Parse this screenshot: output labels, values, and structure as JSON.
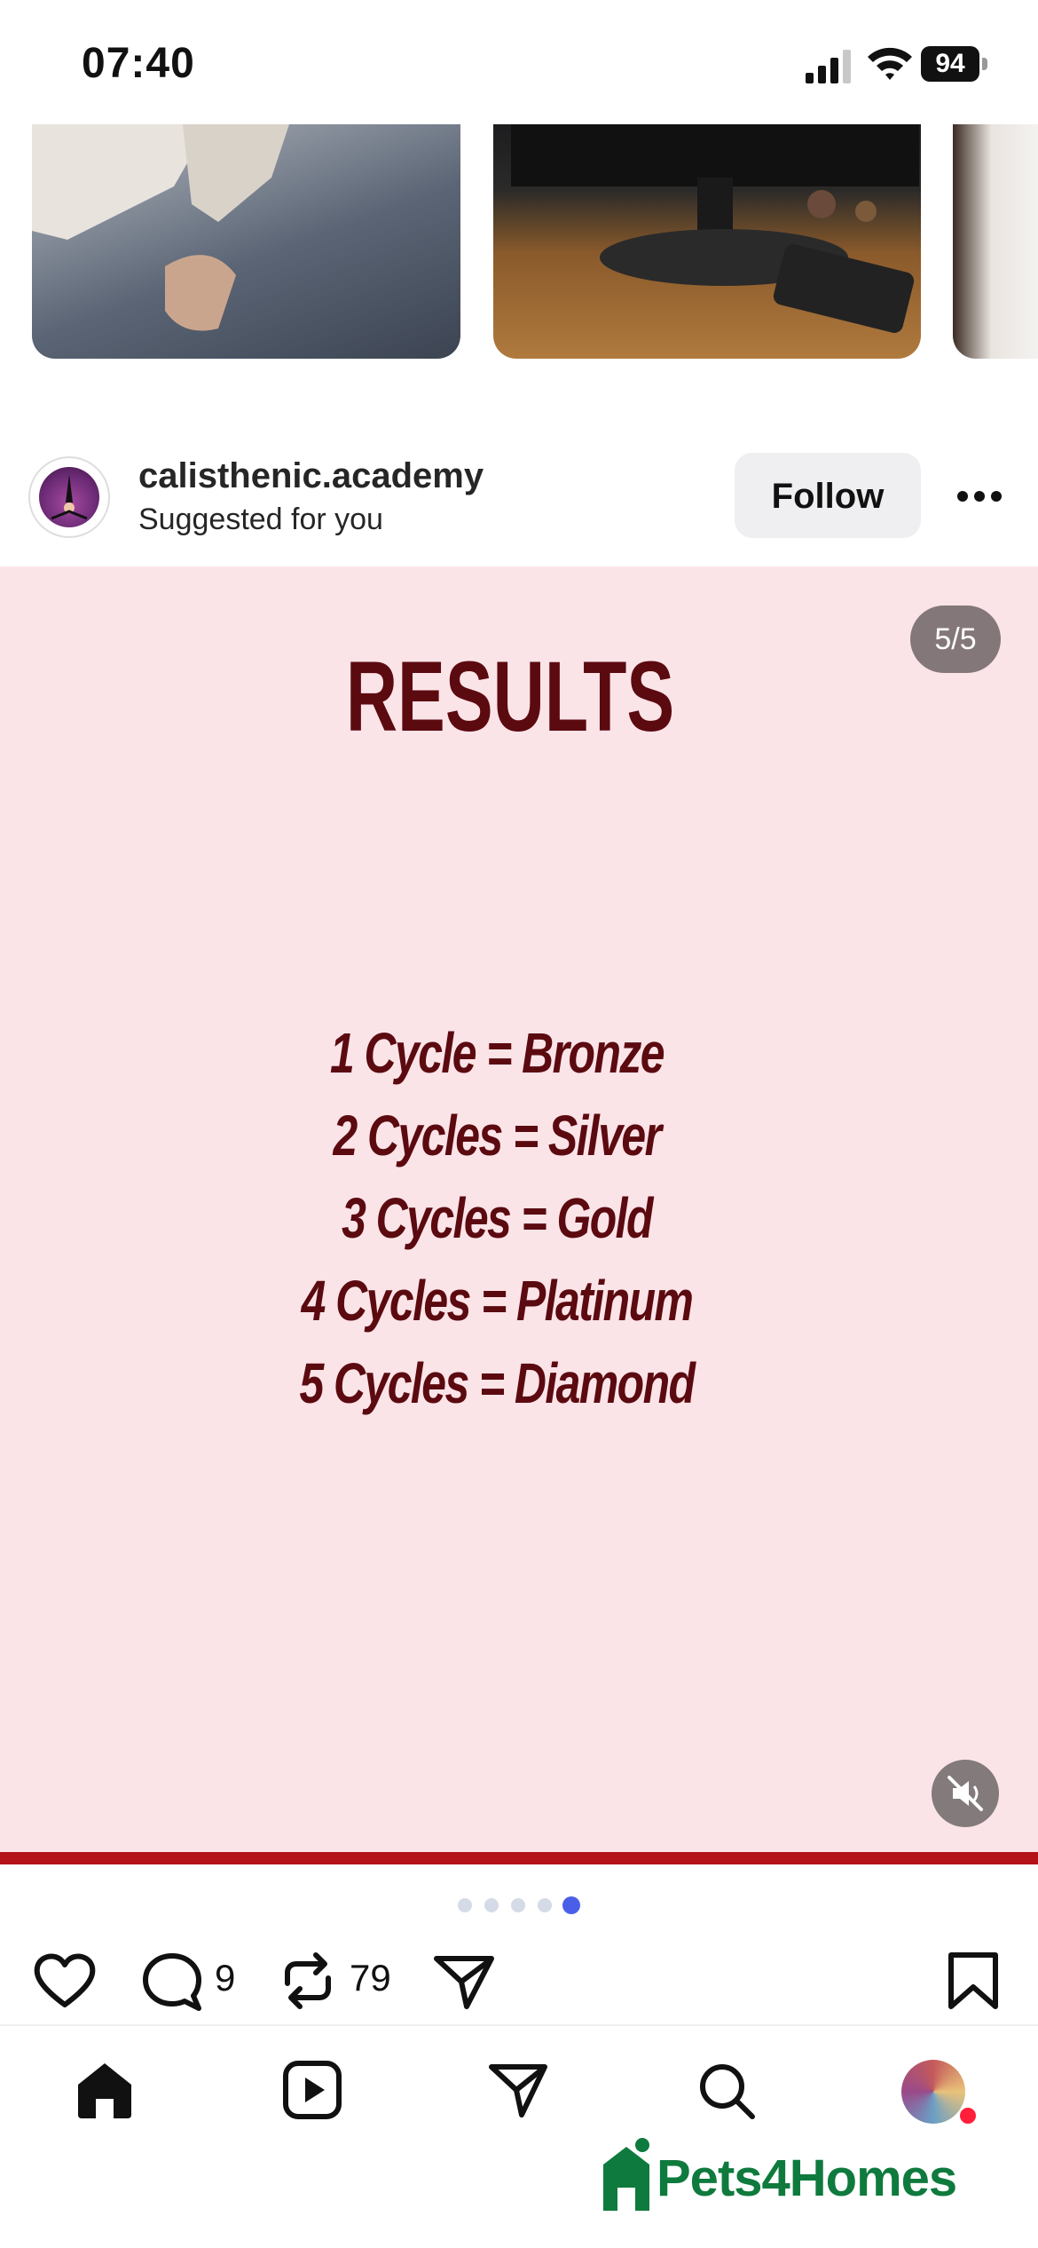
{
  "status_bar": {
    "time": "07:40",
    "battery": "94",
    "icons": [
      "signal-icon",
      "wifi-icon",
      "battery-icon"
    ]
  },
  "post": {
    "username": "calisthenic.academy",
    "subtitle": "Suggested for you",
    "follow_label": "Follow",
    "slide_counter": "5/5",
    "slide": {
      "title": "RESULTS",
      "lines": [
        "1 Cycle = Bronze",
        "2 Cycles = Silver",
        "3 Cycles = Gold",
        "4 Cycles = Platinum",
        "5 Cycles = Diamond"
      ]
    },
    "carousel": {
      "total": 5,
      "active_index": 4
    },
    "actions": {
      "comments_count": "9",
      "reposts_count": "79"
    }
  },
  "nav": {
    "items": [
      "home-icon",
      "reels-icon",
      "messages-icon",
      "search-icon",
      "profile-avatar"
    ]
  },
  "ad": {
    "logo_text": "Pets4Homes"
  },
  "colors": {
    "slide_background": "#fbe4e8",
    "slide_text": "#5b0a10",
    "progress_bar": "#b31318",
    "active_dot": "#4a5fe8",
    "brand_green": "#0f7a3d"
  }
}
